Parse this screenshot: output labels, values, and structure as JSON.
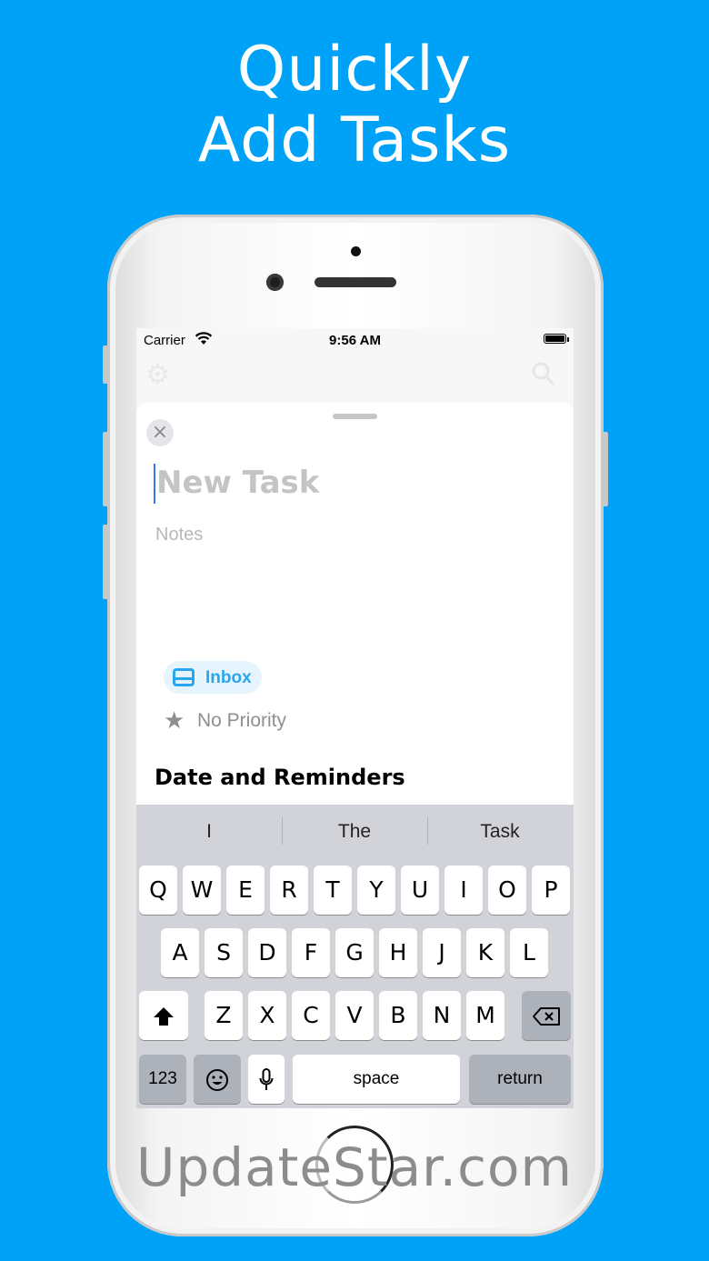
{
  "headline": {
    "line1": "Quickly",
    "line2": "Add Tasks"
  },
  "status_bar": {
    "carrier": "Carrier",
    "time": "9:56 AM"
  },
  "sheet": {
    "title_placeholder": "New Task",
    "notes_placeholder": "Notes",
    "list_chip": "Inbox",
    "priority": "No Priority",
    "section_heading": "Date and Reminders"
  },
  "keyboard": {
    "suggestions": [
      "I",
      "The",
      "Task"
    ],
    "row1": [
      "Q",
      "W",
      "E",
      "R",
      "T",
      "Y",
      "U",
      "I",
      "O",
      "P"
    ],
    "row2": [
      "A",
      "S",
      "D",
      "F",
      "G",
      "H",
      "J",
      "K",
      "L"
    ],
    "row3": [
      "Z",
      "X",
      "C",
      "V",
      "B",
      "N",
      "M"
    ],
    "numbers_key": "123",
    "space_key": "space",
    "return_key": "return"
  },
  "watermark": "UpdateStar.com",
  "colors": {
    "background": "#00a2f7",
    "accent": "#2aa6ee",
    "caret": "#3478f6"
  }
}
